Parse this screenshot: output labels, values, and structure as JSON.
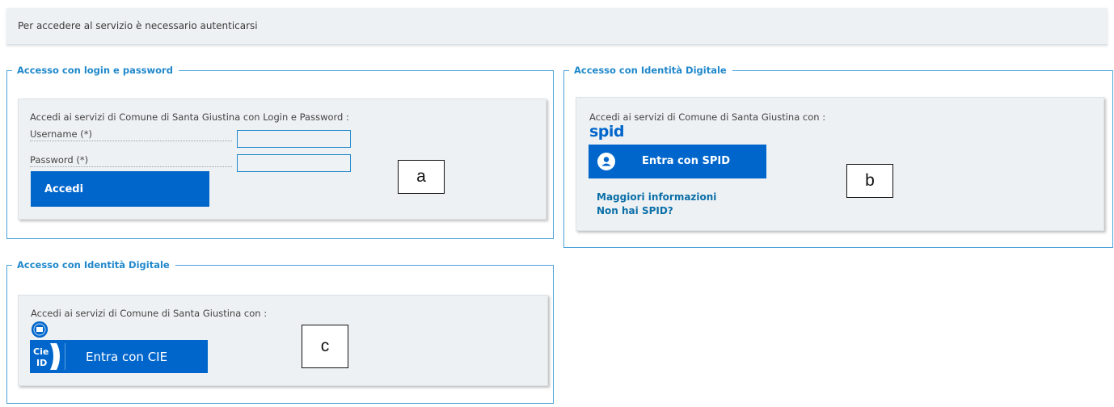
{
  "banner": {
    "text": "Per accedere al servizio è necessario autenticarsi"
  },
  "login_panel": {
    "legend": "Accesso con login e password",
    "intro": "Accedi ai servizi di Comune di Santa Giustina con Login e Password :",
    "username_label": "Username (*)",
    "username_value": "",
    "password_label": "Password (*)",
    "password_value": "",
    "submit_label": "Accedi",
    "annotation": "a"
  },
  "spid_panel": {
    "legend": "Accesso con Identità Digitale",
    "intro": "Accedi ai servizi di Comune di Santa Giustina con :",
    "logo_text": "spid",
    "button_label": "Entra con SPID",
    "link_more_info": "Maggiori informazioni",
    "link_no_spid": "Non hai SPID?",
    "annotation": "b"
  },
  "cie_panel": {
    "legend": "Accesso con Identità Digitale",
    "intro": "Accedi ai servizi di Comune di Santa Giustina con :",
    "button_label": "Entra con CIE",
    "badge_text_top": "Cie",
    "badge_text_bottom": "ID",
    "annotation": "c"
  },
  "colors": {
    "primary_blue": "#0066cc",
    "legend_blue": "#1f88cb",
    "card_bg": "#eef1f3",
    "link_blue": "#0b6fa8"
  },
  "icons": [
    "spid-user-icon",
    "cie-logo-icon",
    "cie-mini-icon"
  ]
}
